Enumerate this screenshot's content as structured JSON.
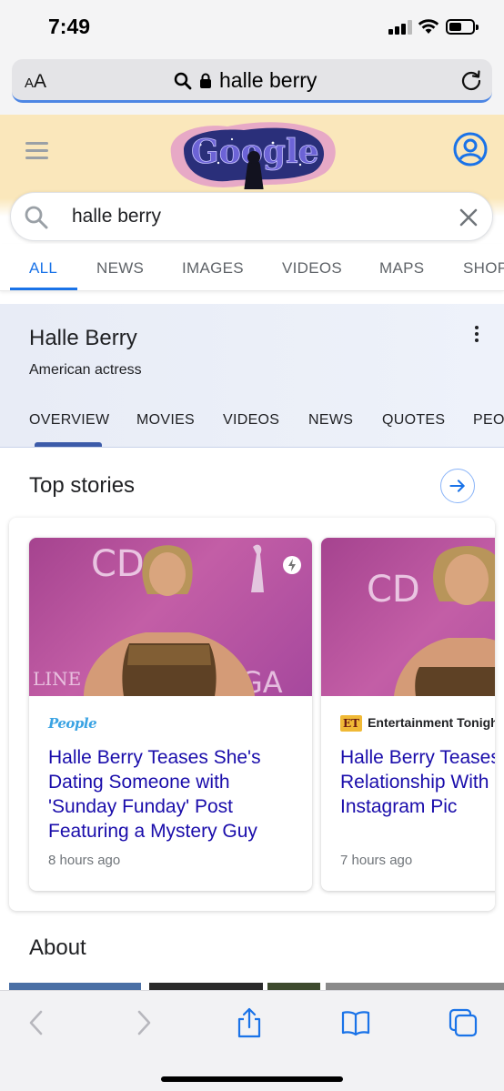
{
  "status_bar": {
    "time": "7:49"
  },
  "browser": {
    "text_size_label_small": "A",
    "text_size_label_large": "A",
    "url_text": "halle berry",
    "icons": [
      "search-icon",
      "lock-icon",
      "reload-icon"
    ]
  },
  "google": {
    "logo_text": "Google",
    "search_query": "halle berry",
    "tabs": [
      {
        "label": "ALL",
        "active": true
      },
      {
        "label": "NEWS"
      },
      {
        "label": "IMAGES"
      },
      {
        "label": "VIDEOS"
      },
      {
        "label": "MAPS"
      },
      {
        "label": "SHOPPING"
      }
    ]
  },
  "knowledge_panel": {
    "name": "Halle Berry",
    "description": "American actress",
    "tabs": [
      {
        "label": "OVERVIEW",
        "active": true
      },
      {
        "label": "MOVIES"
      },
      {
        "label": "VIDEOS"
      },
      {
        "label": "NEWS"
      },
      {
        "label": "QUOTES"
      },
      {
        "label": "PEOPLE"
      }
    ]
  },
  "top_stories": {
    "title": "Top stories",
    "cards": [
      {
        "source": "People",
        "source_color": "#3aa3e3",
        "headline": "Halle Berry Teases She's Dating Someone with 'Sunday Funday' Post Featuring a Mystery Guy",
        "time": "8 hours ago",
        "image_backdrop_text_1": "CD",
        "image_backdrop_text_2": "LINE",
        "image_backdrop_text_3": "GA",
        "amp": true
      },
      {
        "source": "Entertainment Tonight",
        "source_badge": "ET",
        "headline": "Halle Berry Teases Relationship With F Instagram Pic",
        "time": "7 hours ago",
        "image_backdrop_text_1": "CD"
      }
    ]
  },
  "about": {
    "title": "About"
  },
  "toolbar": {
    "buttons": [
      "back-icon",
      "forward-icon",
      "share-icon",
      "bookmarks-icon",
      "tabs-icon"
    ]
  },
  "colors": {
    "accent_blue": "#1a73e8",
    "link_blue": "#1a0dab",
    "doodle_banner": "#fae7bb",
    "knowledge_panel_bg": "#e8ecf6"
  }
}
